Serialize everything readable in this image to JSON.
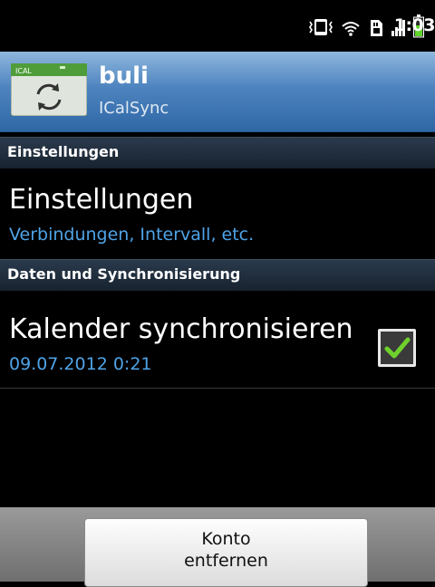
{
  "status_bar": {
    "time": "1:03",
    "icons": [
      "vibrate-icon",
      "wifi-icon",
      "sd-card-icon",
      "signal-icon",
      "battery-icon"
    ]
  },
  "account": {
    "name": "buli",
    "type": "ICalSync",
    "icon": "ical-sync-icon",
    "icon_label": "ICAL"
  },
  "sections": [
    {
      "header": "Einstellungen",
      "items": [
        {
          "title": "Einstellungen",
          "summary": "Verbindungen, Intervall, etc."
        }
      ]
    },
    {
      "header": "Daten und Synchronisierung",
      "items": [
        {
          "title": "Kalender synchronisieren",
          "summary": "09.07.2012 0:21",
          "checked": true
        }
      ]
    }
  ],
  "actions": {
    "remove_account": "Konto\nentfernen"
  },
  "colors": {
    "title_bar": "#4d84bf",
    "summary_text": "#4fa3e6",
    "checkbox_check": "#6fd12c"
  }
}
